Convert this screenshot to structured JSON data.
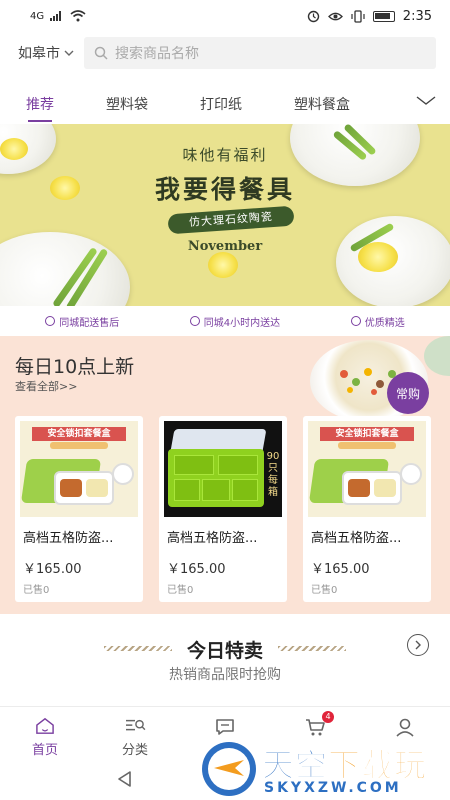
{
  "status_bar": {
    "signal_label": "4G",
    "time": "2:35"
  },
  "header": {
    "city": "如皋市",
    "search_placeholder": "搜索商品名称"
  },
  "tabs": [
    {
      "label": "推荐",
      "active": true
    },
    {
      "label": "塑料袋",
      "active": false
    },
    {
      "label": "打印纸",
      "active": false
    },
    {
      "label": "塑料餐盒",
      "active": false
    }
  ],
  "banner": {
    "small_text": "味他有福利",
    "title": "我要得餐具",
    "pill": "仿大理石纹陶瓷",
    "month": "November",
    "background_color": "#e9e28f"
  },
  "services": [
    {
      "icon": "v-badge-icon",
      "label": "同城配送售后"
    },
    {
      "icon": "clock-icon",
      "label": "同城4小时内送达"
    },
    {
      "icon": "check-circle-icon",
      "label": "优质精选"
    }
  ],
  "daily": {
    "title": "每日10点上新",
    "more": "查看全部>>",
    "badge": "常购",
    "background_color": "#fbe3d6",
    "products": [
      {
        "name": "高档五格防盗...",
        "price": "￥165.00",
        "sold": "已售0",
        "image_banner": "安全锁扣套餐盒",
        "image": "green-tray-set"
      },
      {
        "name": "高档五格防盗...",
        "price": "￥165.00",
        "sold": "已售0",
        "image_count": "90只每箱",
        "image": "lime-tray-with-lid"
      },
      {
        "name": "高档五格防盗...",
        "price": "￥165.00",
        "sold": "已售0",
        "image_banner": "安全锁扣套餐盒",
        "image": "green-tray-set"
      }
    ]
  },
  "today": {
    "title": "今日特卖",
    "subtitle": "热销商品限时抢购"
  },
  "bottom_nav": [
    {
      "label": "首页",
      "icon": "home-icon",
      "active": true
    },
    {
      "label": "分类",
      "icon": "category-search-icon",
      "active": false
    },
    {
      "label": "",
      "icon": "chat-icon",
      "active": false
    },
    {
      "label": "",
      "icon": "cart-icon",
      "active": false,
      "badge": "4"
    },
    {
      "label": "",
      "icon": "user-icon",
      "active": false
    }
  ],
  "watermark": {
    "cn_part1": "天空",
    "cn_part2": "下载玩",
    "en": "SKYXZW.COM"
  },
  "accent_color": "#7a3fa0"
}
